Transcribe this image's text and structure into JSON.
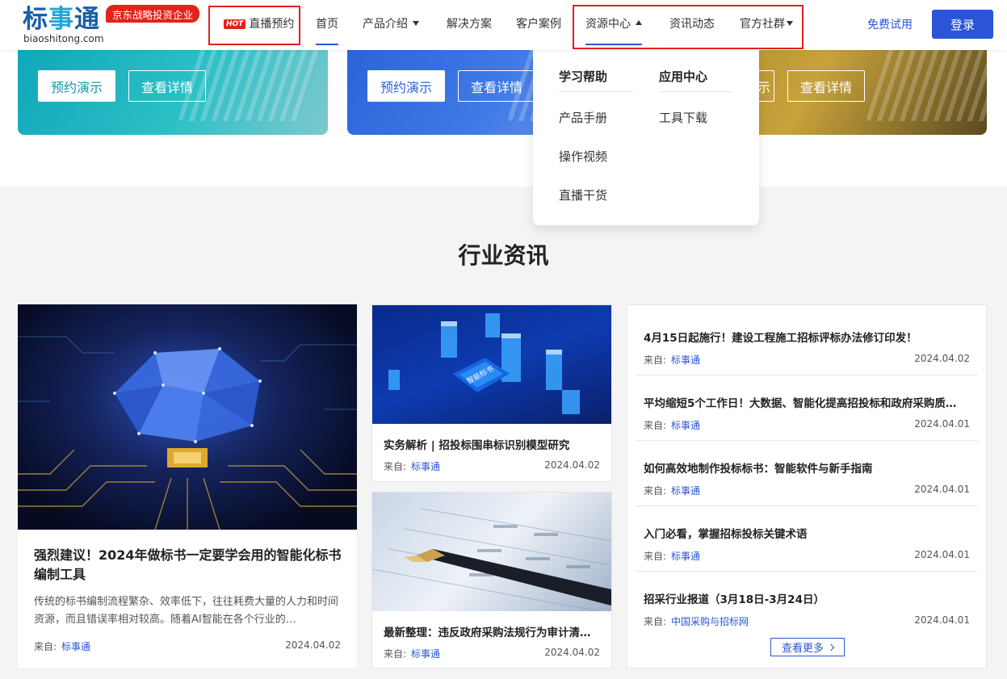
{
  "header": {
    "logo_main_1": "标",
    "logo_main_2": "事",
    "logo_main_3": "通",
    "logo_sub": "biaoshitong.com",
    "jd_badge": "京东战略投资企业",
    "nav": {
      "live_hot": "HOT",
      "live": "直播预约",
      "home": "首页",
      "products": "产品介绍",
      "solutions": "解决方案",
      "cases": "客户案例",
      "resources": "资源中心",
      "news": "资讯动态",
      "community": "官方社群"
    },
    "free_trial": "免费试用",
    "login": "登录"
  },
  "promos": [
    {
      "demo": "预约演示",
      "detail": "查看详情"
    },
    {
      "demo": "预约演示",
      "detail": "查看详情"
    },
    {
      "detail_partial": "示",
      "detail": "查看详情"
    }
  ],
  "dropdown": {
    "col1": {
      "heading": "学习帮助",
      "links": [
        "产品手册",
        "操作视频",
        "直播干货"
      ]
    },
    "col2": {
      "heading": "应用中心",
      "links": [
        "工具下载"
      ]
    }
  },
  "section": {
    "title": "行业资讯",
    "source_label": "来自:",
    "big": {
      "title": "强烈建议！2024年做标书一定要学会用的智能化标书编制工具",
      "desc": "传统的标书编制流程繁杂、效率低下，往往耗费大量的人力和时间资源，而且错误率相对较高。随着AI智能在各个行业的…",
      "source": "标事通",
      "date": "2024.04.02"
    },
    "mid": [
      {
        "title": "实务解析 | 招投标围串标识别模型研究",
        "source": "标事通",
        "date": "2024.04.02",
        "chip": "智能标书"
      },
      {
        "title": "最新整理：违反政府采购法规行为审计清…",
        "source": "标事通",
        "date": "2024.04.02"
      }
    ],
    "news": [
      {
        "title": "4月15日起施行！建设工程施工招标评标办法修订印发！",
        "source": "标事通",
        "date": "2024.04.02"
      },
      {
        "title": "平均缩短5个工作日！大数据、智能化提高招投标和政府采购质…",
        "source": "标事通",
        "date": "2024.04.01"
      },
      {
        "title": "如何高效地制作投标标书：智能软件与新手指南",
        "source": "标事通",
        "date": "2024.04.01"
      },
      {
        "title": "入门必看，掌握招标投标关键术语",
        "source": "标事通",
        "date": "2024.04.01"
      },
      {
        "title": "招采行业报道（3月18日-3月24日）",
        "source": "中国采购与招标网",
        "date": "2024.04.01"
      }
    ],
    "more": "查看更多"
  },
  "colors": {
    "accent": "#2b55d6",
    "hot": "#e2231a",
    "highlight_box": "#e02020"
  }
}
